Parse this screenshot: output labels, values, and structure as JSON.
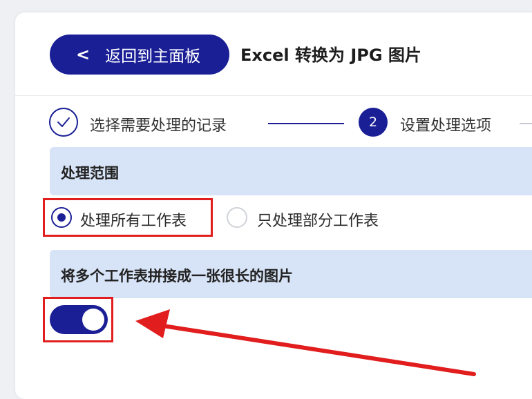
{
  "header": {
    "back_label": "返回到主面板",
    "back_icon": "chevron-left-icon",
    "title": "Excel 转换为 JPG 图片"
  },
  "steps": [
    {
      "index": "1",
      "label": "选择需要处理的记录",
      "status": "done",
      "icon": "check-icon"
    },
    {
      "index": "2",
      "label": "设置处理选项",
      "status": "active"
    }
  ],
  "scope": {
    "title": "处理范围",
    "options": [
      {
        "label": "处理所有工作表",
        "selected": true
      },
      {
        "label": "只处理部分工作表",
        "selected": false
      }
    ]
  },
  "merge": {
    "title": "将多个工作表拼接成一张很长的图片",
    "enabled": true
  },
  "colors": {
    "accent": "#1a1f96",
    "section_bg": "#d7e3f6",
    "annotation_red": "#e11d1d"
  }
}
